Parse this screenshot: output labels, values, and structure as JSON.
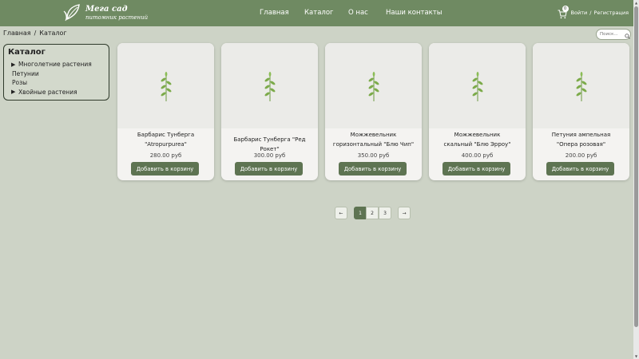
{
  "brand": {
    "title": "Мега сад",
    "subtitle": "питомник растений"
  },
  "nav": {
    "items": [
      "Главная",
      "Каталог",
      "О нас",
      "Наши контакты"
    ]
  },
  "auth": {
    "cart_count": "0",
    "login": "Войти",
    "separator": "/",
    "register": "Регистрация"
  },
  "breadcrumb": {
    "home": "Главная",
    "separator": "/",
    "current": "Каталог"
  },
  "search": {
    "placeholder": "Поиск..."
  },
  "sidebar": {
    "title": "Каталог",
    "items": [
      {
        "label": "Многолетние растения",
        "expandable": true
      },
      {
        "label": "Петунии",
        "expandable": false
      },
      {
        "label": "Розы",
        "expandable": false
      },
      {
        "label": "Хвойные растения",
        "expandable": true
      }
    ]
  },
  "products": [
    {
      "name_line1": "Барбарис Тунберга",
      "name_line2": "\"Atropurpurea\"",
      "price": "280.00 руб",
      "button": "Добавить в корзину"
    },
    {
      "name_line1": "Барбарис Тунберга \"Ред Рокет\"",
      "name_line2": "",
      "price": "300.00 руб",
      "button": "Добавить в корзину"
    },
    {
      "name_line1": "Можжевельник",
      "name_line2": "горизонтальный \"Блю Чип\"",
      "price": "350.00 руб",
      "button": "Добавить в корзину"
    },
    {
      "name_line1": "Можжевельник",
      "name_line2": "скальный \"Блю Эрроу\"",
      "price": "400.00 руб",
      "button": "Добавить в корзину"
    },
    {
      "name_line1": "Петуния ампельная",
      "name_line2": "\"Опера розовая\"",
      "price": "200.00 руб",
      "button": "Добавить в корзину"
    }
  ],
  "pagination": {
    "prev": "←",
    "pages": [
      "1",
      "2",
      "3"
    ],
    "current": "1",
    "next": "→"
  },
  "colors": {
    "header": "#6f8a62",
    "accent": "#5e7452",
    "background": "#cdd3c6",
    "card": "#f4f3f1"
  }
}
